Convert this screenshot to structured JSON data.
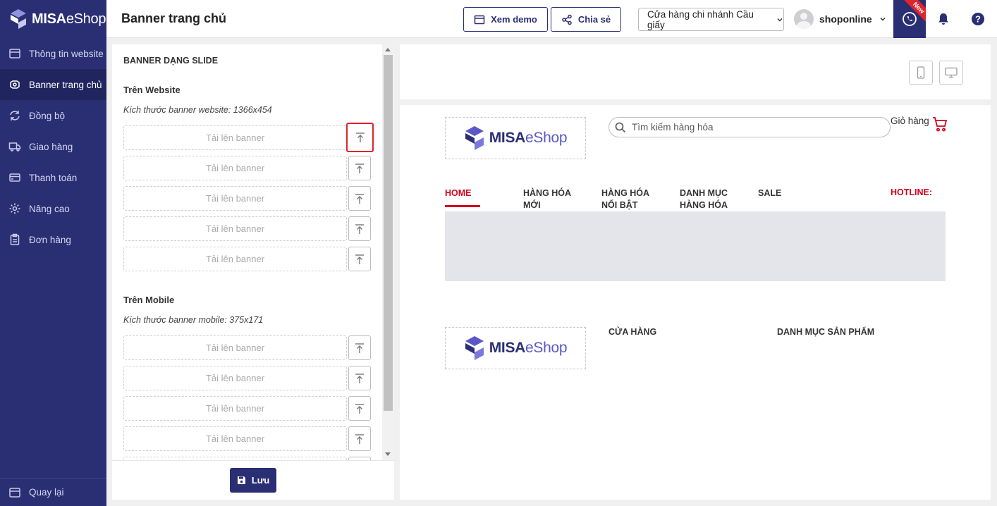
{
  "brand": {
    "name_bold": "MISA",
    "name_light": "eShop"
  },
  "sidebar": {
    "items": [
      {
        "label": "Thông tin website",
        "icon": "browser-window-icon"
      },
      {
        "label": "Banner trang chủ",
        "icon": "banner-icon",
        "active": true
      },
      {
        "label": "Đồng bộ",
        "icon": "sync-icon"
      },
      {
        "label": "Giao hàng",
        "icon": "truck-icon"
      },
      {
        "label": "Thanh toán",
        "icon": "credit-card-icon"
      },
      {
        "label": "Nâng cao",
        "icon": "gear-icon"
      },
      {
        "label": "Đơn hàng",
        "icon": "clipboard-icon"
      }
    ],
    "back_label": "Quay lại"
  },
  "header": {
    "title": "Banner trang chủ",
    "demo_label": "Xem demo",
    "share_label": "Chia sẻ",
    "branch": "Cửa hàng chi nhánh Cầu giấy",
    "user": "shoponline",
    "new_badge": "New"
  },
  "panel": {
    "heading": "BANNER DẠNG SLIDE",
    "website": {
      "title": "Trên Website",
      "hint": "Kích thước banner website: 1366x454"
    },
    "mobile": {
      "title": "Trên Mobile",
      "hint": "Kích thước banner mobile: 375x171"
    },
    "upload_placeholder": "Tải lên banner",
    "save_label": "Lưu"
  },
  "preview": {
    "search_placeholder": "Tìm kiếm hàng hóa",
    "cart_label": "Giỏ hàng",
    "menu": {
      "home": "HOME",
      "new_1": "HÀNG HÓA",
      "new_2": "MỚI",
      "featured_1": "HÀNG HÓA",
      "featured_2": "NỔI BẬT",
      "category_1": "DANH MỤC",
      "category_2": "HÀNG HÓA",
      "sale": "SALE"
    },
    "hotline": "HOTLINE:",
    "footer": {
      "store": "CỬA HÀNG",
      "categories": "DANH MỤC SẢN PHẨM"
    }
  },
  "colors": {
    "primary": "#2a2f74",
    "accent_red": "#d0021b",
    "banner_bg": "#e4e5ea"
  }
}
